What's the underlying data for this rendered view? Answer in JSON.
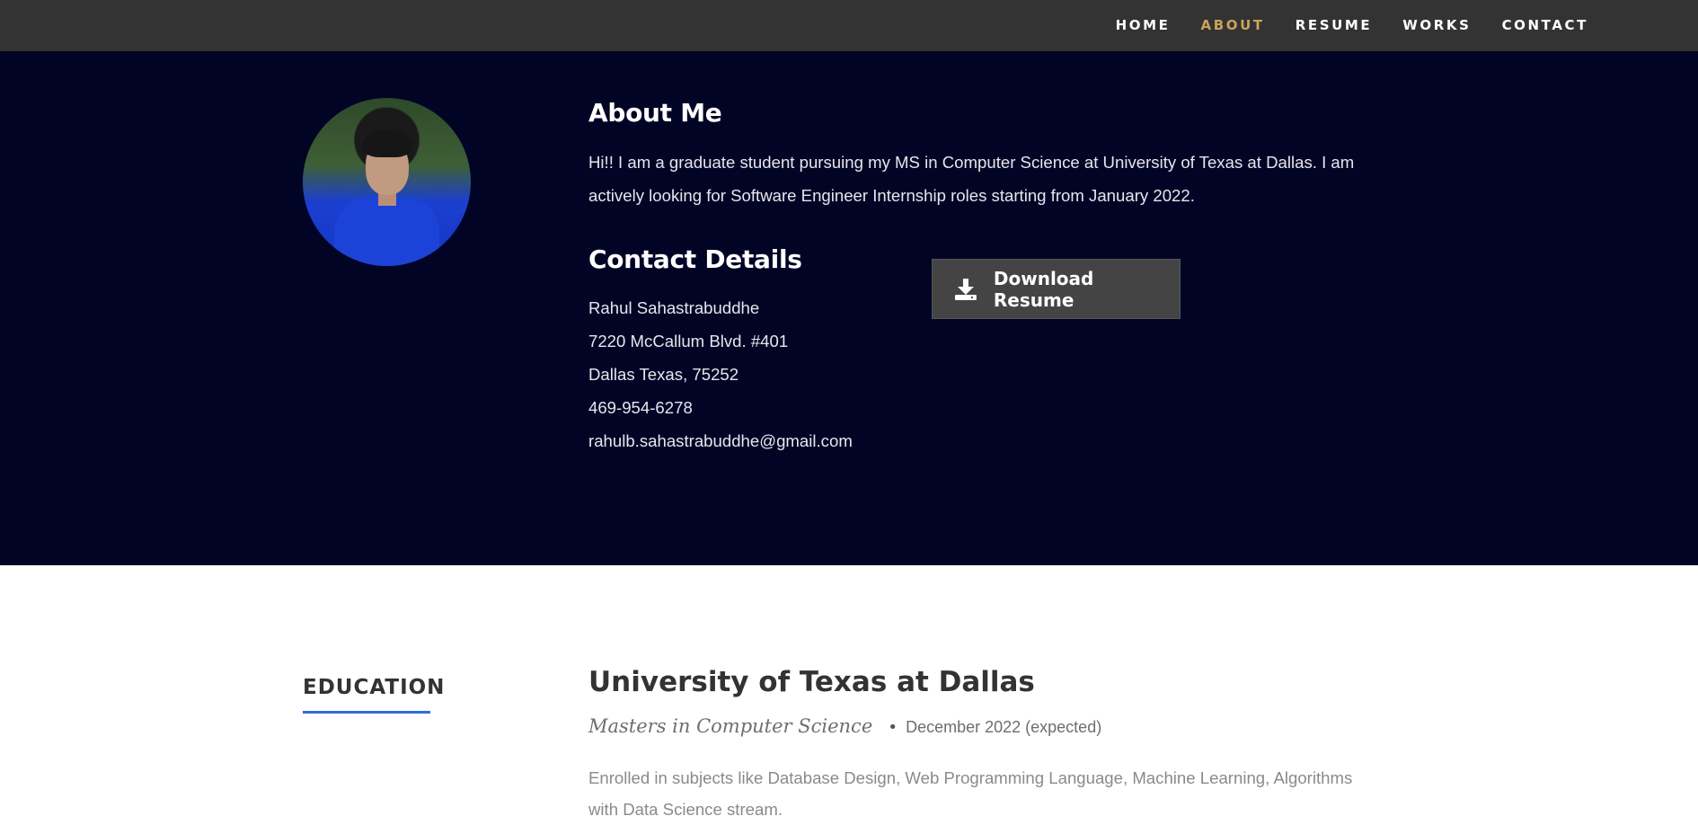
{
  "nav": {
    "items": [
      {
        "label": "HOME"
      },
      {
        "label": "ABOUT"
      },
      {
        "label": "RESUME"
      },
      {
        "label": "WORKS"
      },
      {
        "label": "CONTACT"
      }
    ],
    "active": "ABOUT",
    "active_color": "#c8a45b"
  },
  "about": {
    "title": "About Me",
    "text": "Hi!! I am a graduate student pursuing my MS in Computer Science at University of Texas at Dallas. I am actively looking for Software Engineer Internship roles starting from January 2022.",
    "contact_title": "Contact Details",
    "contact": {
      "name": "Rahul Sahastrabuddhe",
      "address1": "7220 McCallum Blvd. #401",
      "address2": "Dallas Texas, 75252",
      "phone": "469-954-6278",
      "email": "rahulb.sahastrabuddhe@gmail.com"
    },
    "download_label": "Download Resume",
    "download_icon": "download-icon"
  },
  "education": {
    "heading": "EDUCATION",
    "school": "University of Texas at Dallas",
    "degree": "Masters in Computer Science",
    "date": "December 2022 (expected)",
    "description": "Enrolled in subjects like Database Design, Web Programming Language, Machine Learning, Algorithms with Data Science stream."
  },
  "colors": {
    "nav_bg": "#333333",
    "about_bg": "#020425",
    "accent": "#c8a45b",
    "underline": "#2f6fd6"
  }
}
